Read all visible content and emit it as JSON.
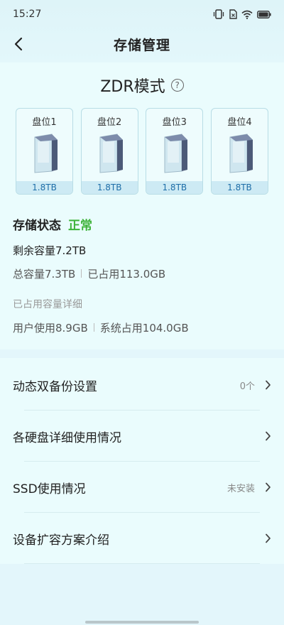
{
  "status_bar": {
    "time": "15:27",
    "icons": [
      "vibrate-icon",
      "sim-icon",
      "wifi-icon",
      "battery-icon"
    ]
  },
  "nav": {
    "title": "存储管理",
    "back_icon": "chevron-left-icon"
  },
  "mode": {
    "title": "ZDR模式",
    "help_icon": "question-mark-icon",
    "help_glyph": "?"
  },
  "disks": [
    {
      "label": "盘位1",
      "size": "1.8TB"
    },
    {
      "label": "盘位2",
      "size": "1.8TB"
    },
    {
      "label": "盘位3",
      "size": "1.8TB"
    },
    {
      "label": "盘位4",
      "size": "1.8TB"
    }
  ],
  "storage": {
    "status_label": "存储状态",
    "status_value": "正常",
    "status_color": "#3eb33a",
    "remaining": "剩余容量7.2TB",
    "total": "总容量7.3TB",
    "used": "已占用113.0GB",
    "detail_title": "已占用容量详细",
    "user_used": "用户使用8.9GB",
    "system_used": "系统占用104.0GB"
  },
  "menu": [
    {
      "label": "动态双备份设置",
      "value": "0个"
    },
    {
      "label": "各硬盘详细使用情况",
      "value": ""
    },
    {
      "label": "SSD使用情况",
      "value": "未安装"
    },
    {
      "label": "设备扩容方案介绍",
      "value": ""
    }
  ],
  "colors": {
    "accent_blue": "#1e6ea8",
    "background": "#e3f6fb",
    "card": "#eafcfd"
  }
}
